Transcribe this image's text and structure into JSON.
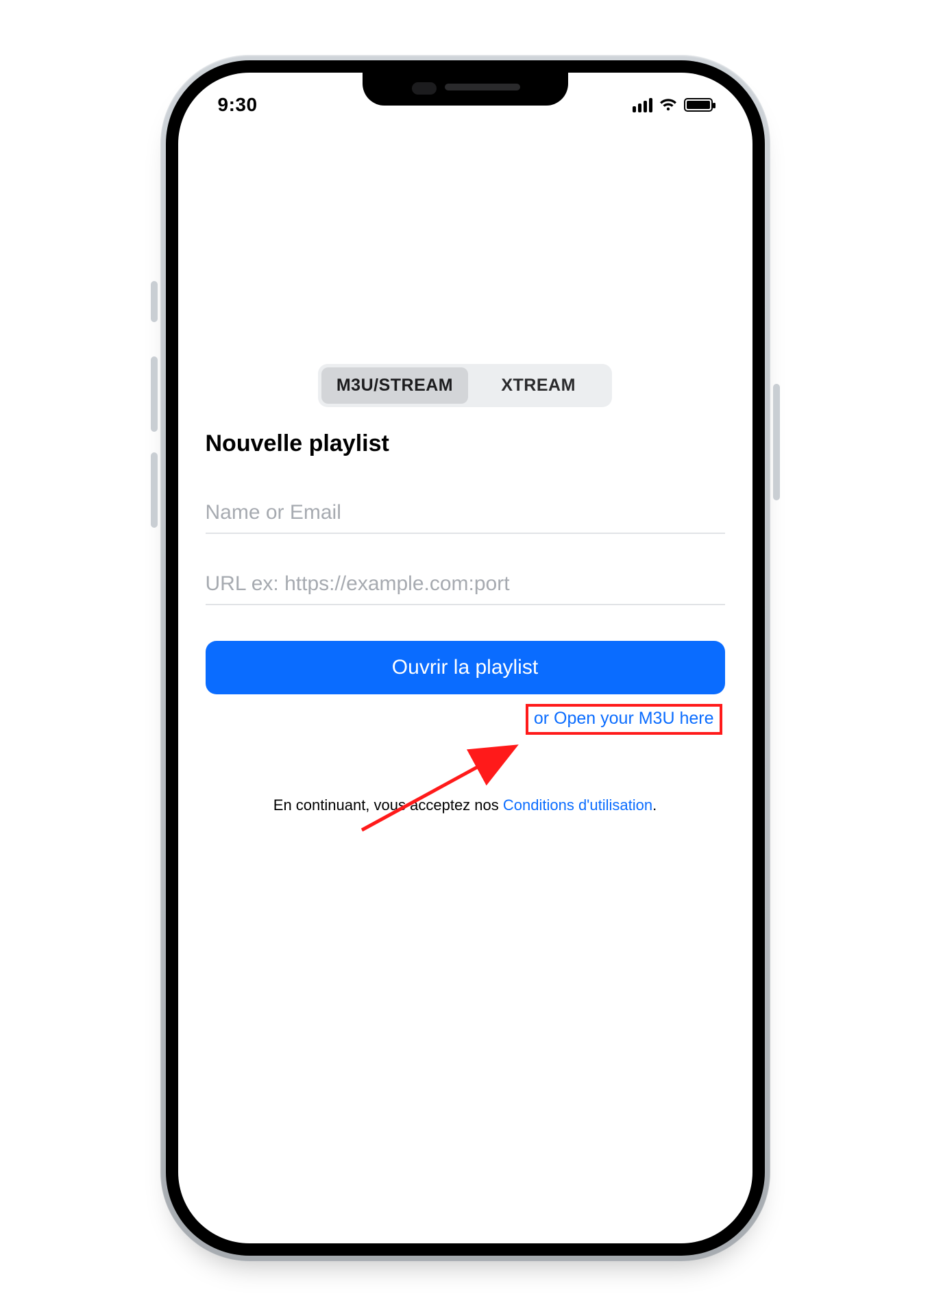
{
  "status": {
    "time": "9:30"
  },
  "segmented": {
    "m3u": "M3U/STREAM",
    "xtream": "XTREAM",
    "active": "m3u"
  },
  "title": "Nouvelle playlist",
  "fields": {
    "name_placeholder": "Name or Email",
    "name_value": "",
    "url_placeholder": "URL ex: https://example.com:port",
    "url_value": ""
  },
  "buttons": {
    "open_playlist": "Ouvrir la playlist",
    "open_m3u_here": "or Open your M3U here"
  },
  "terms": {
    "prefix": "En continuant, vous acceptez nos ",
    "link": "Conditions d'utilisation",
    "suffix": "."
  },
  "annotation": {
    "highlight_color": "#ff1a1a"
  }
}
